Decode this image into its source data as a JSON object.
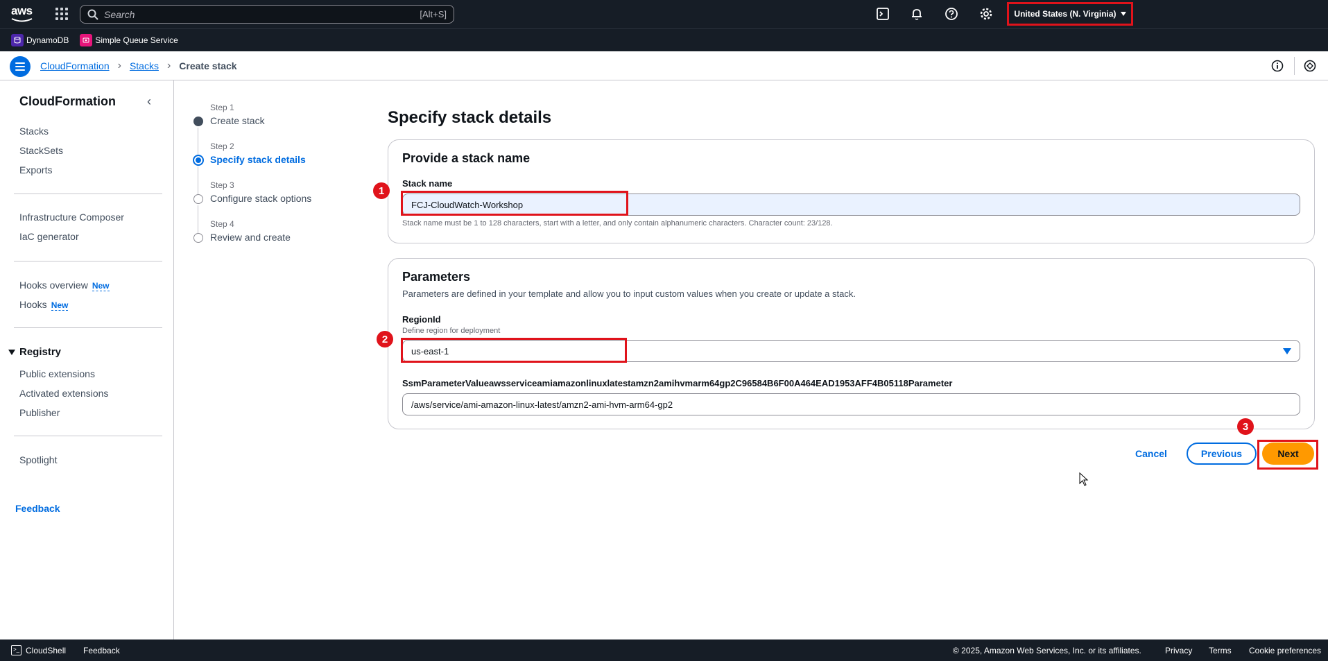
{
  "topnav": {
    "logo_text": "aws",
    "search_placeholder": "Search",
    "search_shortcut": "[Alt+S]",
    "region": "United States (N. Virginia)"
  },
  "favorites": [
    {
      "label": "DynamoDB",
      "color": "#4d27aa"
    },
    {
      "label": "Simple Queue Service",
      "color": "#e7157b"
    }
  ],
  "breadcrumb": {
    "items": [
      "CloudFormation",
      "Stacks"
    ],
    "current": "Create stack"
  },
  "sidenav": {
    "title": "CloudFormation",
    "group1": [
      "Stacks",
      "StackSets",
      "Exports"
    ],
    "group2": [
      "Infrastructure Composer",
      "IaC generator"
    ],
    "hooks_overview": "Hooks overview",
    "hooks": "Hooks",
    "new_badge": "New",
    "registry_title": "Registry",
    "registry_items": [
      "Public extensions",
      "Activated extensions",
      "Publisher"
    ],
    "spotlight": "Spotlight",
    "feedback": "Feedback"
  },
  "steps": [
    {
      "num": "Step 1",
      "label": "Create stack",
      "state": "done"
    },
    {
      "num": "Step 2",
      "label": "Specify stack details",
      "state": "current"
    },
    {
      "num": "Step 3",
      "label": "Configure stack options",
      "state": "pending"
    },
    {
      "num": "Step 4",
      "label": "Review and create",
      "state": "pending"
    }
  ],
  "main": {
    "title": "Specify stack details",
    "stack_panel": {
      "heading": "Provide a stack name",
      "label": "Stack name",
      "value": "FCJ-CloudWatch-Workshop",
      "hint": "Stack name must be 1 to 128 characters, start with a letter, and only contain alphanumeric characters. Character count: 23/128."
    },
    "params_panel": {
      "heading": "Parameters",
      "description": "Parameters are defined in your template and allow you to input custom values when you create or update a stack.",
      "region_label": "RegionId",
      "region_desc": "Define region for deployment",
      "region_value": "us-east-1",
      "ssm_label": "SsmParameterValueawsserviceamiamazonlinuxlatestamzn2amihvmarm64gp2C96584B6F00A464EAD1953AFF4B05118Parameter",
      "ssm_value": "/aws/service/ami-amazon-linux-latest/amzn2-ami-hvm-arm64-gp2"
    },
    "buttons": {
      "cancel": "Cancel",
      "previous": "Previous",
      "next": "Next"
    },
    "callouts": [
      "1",
      "2",
      "3"
    ]
  },
  "footer": {
    "cloudshell": "CloudShell",
    "feedback": "Feedback",
    "copyright": "© 2025, Amazon Web Services, Inc. or its affiliates.",
    "privacy": "Privacy",
    "terms": "Terms",
    "cookies": "Cookie preferences"
  },
  "colors": {
    "accent": "#006ce0",
    "primary_button": "#ff9900",
    "highlight": "#e0131b"
  }
}
